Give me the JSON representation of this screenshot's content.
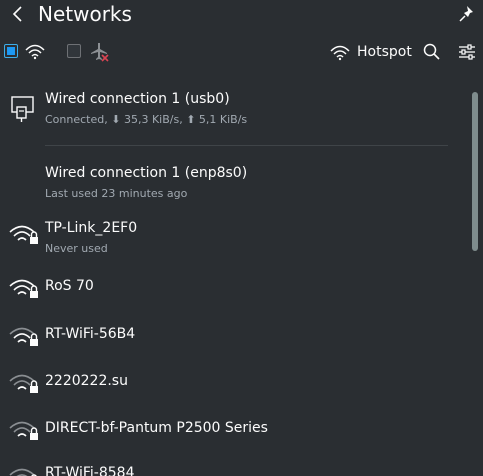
{
  "header": {
    "title": "Networks"
  },
  "toolbar": {
    "wifi_enabled": true,
    "airplane_enabled": false,
    "hotspot_label": "Hotspot"
  },
  "connections": [
    {
      "name": "Wired connection 1 (usb0)",
      "status_prefix": "Connected, ",
      "down": "35,3 KiB/s",
      "sep": ", ",
      "up": "5,1 KiB/s",
      "type": "wired"
    },
    {
      "name": "Wired connection 1 (enp8s0)",
      "status": "Last used 23 minutes ago",
      "type": "wired-noicon"
    },
    {
      "name": "TP-Link_2EF0",
      "status": "Never used",
      "type": "wifi"
    },
    {
      "name": "RoS 70",
      "status": "",
      "type": "wifi"
    },
    {
      "name": "RT-WiFi-56B4",
      "status": "",
      "type": "wifi"
    },
    {
      "name": "2220222.su",
      "status": "",
      "type": "wifi"
    },
    {
      "name": "DIRECT-bf-Pantum P2500 Series",
      "status": "",
      "type": "wifi"
    },
    {
      "name": "RT-WiFi-8584",
      "status": "",
      "type": "wifi"
    }
  ],
  "colors": {
    "background": "#2a2e32",
    "accent": "#1d99f3",
    "text": "#fcfcfc",
    "subtext": "#a1a9b1"
  }
}
